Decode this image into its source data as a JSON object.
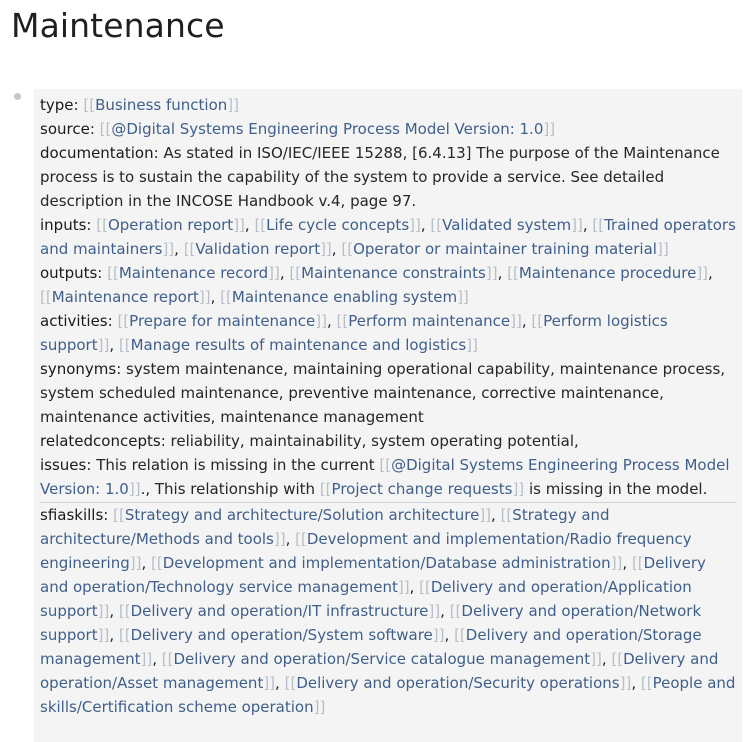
{
  "page": {
    "title": "Maintenance"
  },
  "properties": {
    "type": {
      "key": "type",
      "links": [
        "Business function"
      ]
    },
    "source": {
      "key": "source",
      "links": [
        "@Digital Systems Engineering Process Model Version: 1.0"
      ]
    },
    "documentation": {
      "key": "documentation",
      "text": "As stated in ISO/IEC/IEEE 15288, [6.4.13] The purpose of the Maintenance process is to sustain the capability of the system to provide a service.  See detailed description in the INCOSE Handbook v.4, page 97."
    },
    "inputs": {
      "key": "inputs",
      "links": [
        "Operation report",
        "Life cycle concepts",
        "Validated system",
        "Trained operators and maintainers",
        "Validation report",
        "Operator or maintainer training material"
      ]
    },
    "outputs": {
      "key": "outputs",
      "links": [
        "Maintenance record",
        "Maintenance constraints",
        "Maintenance procedure",
        "Maintenance report",
        "Maintenance enabling system"
      ]
    },
    "activities": {
      "key": "activities",
      "links": [
        "Prepare for maintenance",
        "Perform maintenance",
        "Perform logistics support",
        "Manage results of maintenance and logistics"
      ]
    },
    "synonyms": {
      "key": "synonyms",
      "text": "system maintenance, maintaining operational capability, maintenance process, system scheduled maintenance, preventive maintenance, corrective maintenance, maintenance activities, maintenance management"
    },
    "relatedconcepts": {
      "key": "relatedconcepts",
      "text": "reliability, maintainability, system operating potential,"
    },
    "issues": {
      "key": "issues",
      "text_1": "This relation is missing in the current ",
      "link_1": "@Digital Systems Engineering Process Model Version: 1.0",
      "text_2": "., This relationship with ",
      "link_2": "Project change requests",
      "text_3": " is missing in the model."
    },
    "sfiaskills": {
      "key": "sfiaskills",
      "links": [
        "Strategy and architecture/Solution architecture",
        "Strategy and architecture/Methods and tools",
        "Development and implementation/Radio frequency engineering",
        "Development and implementation/Database administration",
        "Delivery and operation/Technology service management",
        "Delivery and operation/Application support",
        "Delivery and operation/IT infrastructure",
        "Delivery and operation/Network support",
        "Delivery and operation/System software",
        "Delivery and operation/Storage management",
        "Delivery and operation/Service catalogue management",
        "Delivery and operation/Asset management",
        "Delivery and operation/Security operations",
        "People and skills/Certification scheme operation"
      ]
    }
  },
  "syntax": {
    "link_open": "[[",
    "link_close": "]]",
    "separator": ", ",
    "colon": ": "
  },
  "colors": {
    "link": "#3f5f8a",
    "brackets": "#b7bec7",
    "block_bg": "#f4f4f4",
    "text": "#262626"
  }
}
